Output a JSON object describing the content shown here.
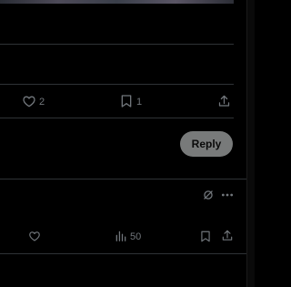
{
  "tweet_actions": {
    "like_count": "2",
    "bookmark_count": "1"
  },
  "reply_composer": {
    "reply_label": "Reply"
  },
  "reply_post": {
    "views_count": "50"
  },
  "colors": {
    "background": "#000000",
    "divider": "#2f3336",
    "icon": "#71767b",
    "reply_button_bg": "#787a7a"
  }
}
